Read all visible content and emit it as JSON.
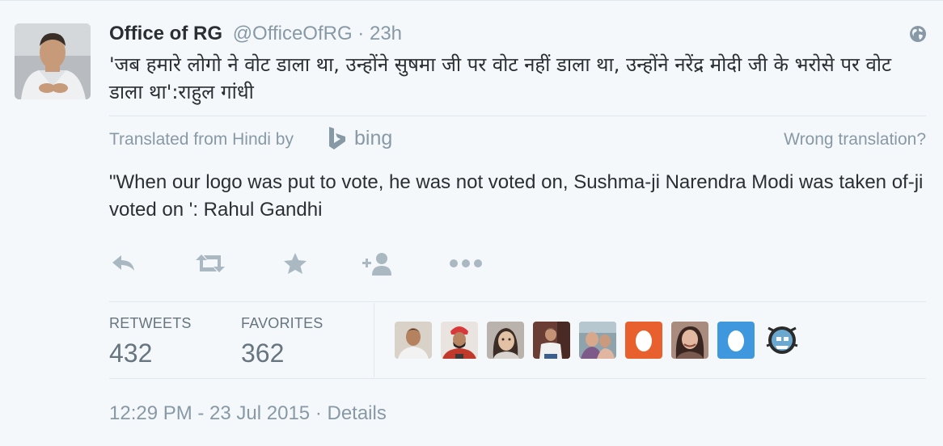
{
  "tweet": {
    "fullname": "Office of RG",
    "handle": "@OfficeOfRG",
    "separator": " · ",
    "time_ago": "23h",
    "text_hindi": "'जब हमारे लोगो ने वोट डाला था, उन्होंने  सुषमा जी पर वोट नहीं डाला था, उन्होंने नरेंद्र मोदी जी के भरोसे पर वोट डाला था':राहुल गांधी",
    "translated_from": "Translated from Hindi by",
    "translator": "bing",
    "wrong_translation": "Wrong translation?",
    "text_english": "\"When our logo was put to vote, he was not voted on, Sushma-ji Narendra Modi was taken of-ji voted on ': Rahul Gandhi"
  },
  "actions": [
    {
      "name": "reply",
      "icon": "reply-icon"
    },
    {
      "name": "retweet",
      "icon": "retweet-icon"
    },
    {
      "name": "favorite",
      "icon": "star-icon"
    },
    {
      "name": "follow",
      "icon": "follow-icon"
    },
    {
      "name": "more",
      "icon": "more-icon"
    }
  ],
  "stats": {
    "retweets_label": "RETWEETS",
    "retweets_value": "432",
    "favorites_label": "FAVORITES",
    "favorites_value": "362"
  },
  "footer": {
    "timestamp": "12:29 PM - 23 Jul 2015",
    "separator": " · ",
    "details": "Details"
  },
  "colors": {
    "background": "#f5f8fa",
    "text": "#292f33",
    "muted": "#8899a6",
    "icon": "#aab8c2",
    "egg_orange": "#e8602e",
    "egg_blue": "#3f98de"
  }
}
